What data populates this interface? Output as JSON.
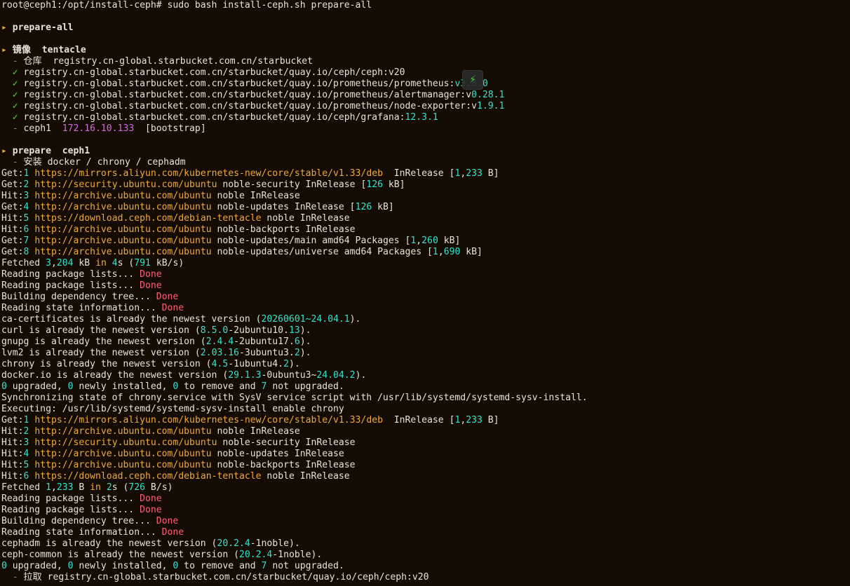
{
  "terminal": {
    "title": "root@ceph1:/opt/install-ceph",
    "palette": {
      "background": "#140c02",
      "text": "#e8e3da",
      "orange": "#f0a93c",
      "green": "#44dd28",
      "dim": "#8a8478",
      "cyan": "#34e2cf",
      "magenta": "#d36ce0",
      "red": "#ff5f77"
    },
    "overlay_badge": {
      "icon": "lightning-icon",
      "glyph": "⚡"
    },
    "lines": [
      [
        [
          "w",
          "root@ceph1:/opt/install-ceph# sudo bash install-ceph.sh prepare-all"
        ]
      ],
      [],
      [
        [
          "o",
          "▸ "
        ],
        [
          "b",
          "prepare-all"
        ]
      ],
      [],
      [
        [
          "o",
          "▸ "
        ],
        [
          "b",
          "镜像  tentacle"
        ]
      ],
      [
        [
          "d",
          "  - "
        ],
        [
          "w",
          "仓库  registry.cn-global.starbucket.com.cn/starbucket"
        ]
      ],
      [
        [
          "g",
          "  ✓ "
        ],
        [
          "w",
          "registry.cn-global.starbucket.com.cn/starbucket/quay.io/ceph/ceph:v20"
        ]
      ],
      [
        [
          "g",
          "  ✓ "
        ],
        [
          "w",
          "registry.cn-global.starbucket.com.cn/starbucket/quay.io/prometheus/prometheus:"
        ],
        [
          "c",
          "v3.8.0"
        ]
      ],
      [
        [
          "g",
          "  ✓ "
        ],
        [
          "w",
          "registry.cn-global.starbucket.com.cn/starbucket/quay.io/prometheus/alertmanager:v"
        ],
        [
          "c",
          "0.28.1"
        ]
      ],
      [
        [
          "g",
          "  ✓ "
        ],
        [
          "w",
          "registry.cn-global.starbucket.com.cn/starbucket/quay.io/prometheus/node-exporter:v"
        ],
        [
          "c",
          "1.9.1"
        ]
      ],
      [
        [
          "g",
          "  ✓ "
        ],
        [
          "w",
          "registry.cn-global.starbucket.com.cn/starbucket/quay.io/ceph/grafana:"
        ],
        [
          "c",
          "12.3.1"
        ]
      ],
      [
        [
          "d",
          "  - "
        ],
        [
          "w",
          "ceph1  "
        ],
        [
          "m",
          "172.16.10.133"
        ],
        [
          "w",
          "  [bootstrap]"
        ]
      ],
      [],
      [
        [
          "o",
          "▸ "
        ],
        [
          "b",
          "prepare  ceph1"
        ]
      ],
      [
        [
          "d",
          "  - "
        ],
        [
          "w",
          "安装 docker / chrony / cephadm"
        ]
      ],
      [
        [
          "w",
          "Get:"
        ],
        [
          "c",
          "1"
        ],
        [
          "w",
          " "
        ],
        [
          "o",
          "https://mirrors.aliyun.com/kubernetes-new/core/stable/v1.33/deb"
        ],
        [
          "w",
          "  InRelease ["
        ],
        [
          "c",
          "1"
        ],
        [
          "w",
          ","
        ],
        [
          "c",
          "233"
        ],
        [
          "w",
          " B]"
        ]
      ],
      [
        [
          "w",
          "Get:"
        ],
        [
          "c",
          "2"
        ],
        [
          "w",
          " "
        ],
        [
          "o",
          "http://security.ubuntu.com/ubuntu"
        ],
        [
          "w",
          " noble-security InRelease ["
        ],
        [
          "c",
          "126"
        ],
        [
          "w",
          " kB]"
        ]
      ],
      [
        [
          "w",
          "Hit:"
        ],
        [
          "c",
          "3"
        ],
        [
          "w",
          " "
        ],
        [
          "o",
          "http://archive.ubuntu.com/ubuntu"
        ],
        [
          "w",
          " noble InRelease"
        ]
      ],
      [
        [
          "w",
          "Get:"
        ],
        [
          "c",
          "4"
        ],
        [
          "w",
          " "
        ],
        [
          "o",
          "http://archive.ubuntu.com/ubuntu"
        ],
        [
          "w",
          " noble-updates InRelease ["
        ],
        [
          "c",
          "126"
        ],
        [
          "w",
          " kB]"
        ]
      ],
      [
        [
          "w",
          "Hit:"
        ],
        [
          "c",
          "5"
        ],
        [
          "w",
          " "
        ],
        [
          "o",
          "https://download.ceph.com/debian-tentacle"
        ],
        [
          "w",
          " noble InRelease"
        ]
      ],
      [
        [
          "w",
          "Hit:"
        ],
        [
          "c",
          "6"
        ],
        [
          "w",
          " "
        ],
        [
          "o",
          "http://archive.ubuntu.com/ubuntu"
        ],
        [
          "w",
          " noble-backports InRelease"
        ]
      ],
      [
        [
          "w",
          "Get:"
        ],
        [
          "c",
          "7"
        ],
        [
          "w",
          " "
        ],
        [
          "o",
          "http://archive.ubuntu.com/ubuntu"
        ],
        [
          "w",
          " noble-updates/main amd64 Packages ["
        ],
        [
          "c",
          "1"
        ],
        [
          "w",
          ","
        ],
        [
          "c",
          "260"
        ],
        [
          "w",
          " kB]"
        ]
      ],
      [
        [
          "w",
          "Get:"
        ],
        [
          "c",
          "8"
        ],
        [
          "w",
          " "
        ],
        [
          "o",
          "http://archive.ubuntu.com/ubuntu"
        ],
        [
          "w",
          " noble-updates/universe amd64 Packages ["
        ],
        [
          "c",
          "1"
        ],
        [
          "w",
          ","
        ],
        [
          "c",
          "690"
        ],
        [
          "w",
          " kB]"
        ]
      ],
      [
        [
          "w",
          "Fetched "
        ],
        [
          "c",
          "3"
        ],
        [
          "w",
          ","
        ],
        [
          "c",
          "204"
        ],
        [
          "w",
          " kB "
        ],
        [
          "o",
          "in"
        ],
        [
          "w",
          " "
        ],
        [
          "c",
          "4"
        ],
        [
          "w",
          "s ("
        ],
        [
          "c",
          "791"
        ],
        [
          "w",
          " kB/s)"
        ]
      ],
      [
        [
          "w",
          "Reading package lists... "
        ],
        [
          "r",
          "Done"
        ]
      ],
      [
        [
          "w",
          "Reading package lists... "
        ],
        [
          "r",
          "Done"
        ]
      ],
      [
        [
          "w",
          "Building dependency tree... "
        ],
        [
          "r",
          "Done"
        ]
      ],
      [
        [
          "w",
          "Reading state information... "
        ],
        [
          "r",
          "Done"
        ]
      ],
      [
        [
          "w",
          "ca-certificates is already the newest version ("
        ],
        [
          "c",
          "20260601~24.04.1"
        ],
        [
          "w",
          ")."
        ]
      ],
      [
        [
          "w",
          "curl is already the newest version ("
        ],
        [
          "c",
          "8.5.0"
        ],
        [
          "w",
          "-2ubuntu10."
        ],
        [
          "c",
          "13"
        ],
        [
          "w",
          ")."
        ]
      ],
      [
        [
          "w",
          "gnupg is already the newest version ("
        ],
        [
          "c",
          "2.4.4"
        ],
        [
          "w",
          "-2ubuntu17."
        ],
        [
          "c",
          "6"
        ],
        [
          "w",
          ")."
        ]
      ],
      [
        [
          "w",
          "lvm2 is already the newest version ("
        ],
        [
          "c",
          "2.03.16"
        ],
        [
          "w",
          "-3ubuntu3."
        ],
        [
          "c",
          "2"
        ],
        [
          "w",
          ")."
        ]
      ],
      [
        [
          "w",
          "chrony is already the newest version ("
        ],
        [
          "c",
          "4.5"
        ],
        [
          "w",
          "-1ubuntu4."
        ],
        [
          "c",
          "2"
        ],
        [
          "w",
          ")."
        ]
      ],
      [
        [
          "w",
          "docker.io is already the newest version ("
        ],
        [
          "c",
          "29.1.3"
        ],
        [
          "w",
          "-0ubuntu3~"
        ],
        [
          "c",
          "24.04.2"
        ],
        [
          "w",
          ")."
        ]
      ],
      [
        [
          "c",
          "0"
        ],
        [
          "w",
          " upgraded, "
        ],
        [
          "c",
          "0"
        ],
        [
          "w",
          " newly installed, "
        ],
        [
          "c",
          "0"
        ],
        [
          "w",
          " to remove and "
        ],
        [
          "c",
          "7"
        ],
        [
          "w",
          " not upgraded."
        ]
      ],
      [
        [
          "w",
          "Synchronizing state of chrony.service with SysV service script with /usr/lib/systemd/systemd-sysv-install."
        ]
      ],
      [
        [
          "w",
          "Executing: /usr/lib/systemd/systemd-sysv-install enable chrony"
        ]
      ],
      [
        [
          "w",
          "Get:"
        ],
        [
          "c",
          "1"
        ],
        [
          "w",
          " "
        ],
        [
          "o",
          "https://mirrors.aliyun.com/kubernetes-new/core/stable/v1.33/deb"
        ],
        [
          "w",
          "  InRelease ["
        ],
        [
          "c",
          "1"
        ],
        [
          "w",
          ","
        ],
        [
          "c",
          "233"
        ],
        [
          "w",
          " B]"
        ]
      ],
      [
        [
          "w",
          "Hit:"
        ],
        [
          "c",
          "2"
        ],
        [
          "w",
          " "
        ],
        [
          "o",
          "http://archive.ubuntu.com/ubuntu"
        ],
        [
          "w",
          " noble InRelease"
        ]
      ],
      [
        [
          "w",
          "Hit:"
        ],
        [
          "c",
          "3"
        ],
        [
          "w",
          " "
        ],
        [
          "o",
          "http://security.ubuntu.com/ubuntu"
        ],
        [
          "w",
          " noble-security InRelease"
        ]
      ],
      [
        [
          "w",
          "Hit:"
        ],
        [
          "c",
          "4"
        ],
        [
          "w",
          " "
        ],
        [
          "o",
          "http://archive.ubuntu.com/ubuntu"
        ],
        [
          "w",
          " noble-updates InRelease"
        ]
      ],
      [
        [
          "w",
          "Hit:"
        ],
        [
          "c",
          "5"
        ],
        [
          "w",
          " "
        ],
        [
          "o",
          "http://archive.ubuntu.com/ubuntu"
        ],
        [
          "w",
          " noble-backports InRelease"
        ]
      ],
      [
        [
          "w",
          "Hit:"
        ],
        [
          "c",
          "6"
        ],
        [
          "w",
          " "
        ],
        [
          "o",
          "https://download.ceph.com/debian-tentacle"
        ],
        [
          "w",
          " noble InRelease"
        ]
      ],
      [
        [
          "w",
          "Fetched "
        ],
        [
          "c",
          "1"
        ],
        [
          "w",
          ","
        ],
        [
          "c",
          "233"
        ],
        [
          "w",
          " B "
        ],
        [
          "o",
          "in"
        ],
        [
          "w",
          " "
        ],
        [
          "c",
          "2"
        ],
        [
          "w",
          "s ("
        ],
        [
          "c",
          "726"
        ],
        [
          "w",
          " B/s)"
        ]
      ],
      [
        [
          "w",
          "Reading package lists... "
        ],
        [
          "r",
          "Done"
        ]
      ],
      [
        [
          "w",
          "Reading package lists... "
        ],
        [
          "r",
          "Done"
        ]
      ],
      [
        [
          "w",
          "Building dependency tree... "
        ],
        [
          "r",
          "Done"
        ]
      ],
      [
        [
          "w",
          "Reading state information... "
        ],
        [
          "r",
          "Done"
        ]
      ],
      [
        [
          "w",
          "cephadm is already the newest version ("
        ],
        [
          "c",
          "20.2.4"
        ],
        [
          "w",
          "-1noble)."
        ]
      ],
      [
        [
          "w",
          "ceph-common is already the newest version ("
        ],
        [
          "c",
          "20.2.4"
        ],
        [
          "w",
          "-1noble)."
        ]
      ],
      [
        [
          "c",
          "0"
        ],
        [
          "w",
          " upgraded, "
        ],
        [
          "c",
          "0"
        ],
        [
          "w",
          " newly installed, "
        ],
        [
          "c",
          "0"
        ],
        [
          "w",
          " to remove and "
        ],
        [
          "c",
          "7"
        ],
        [
          "w",
          " not upgraded."
        ]
      ],
      [
        [
          "d",
          "  - "
        ],
        [
          "w",
          "拉取 registry.cn-global.starbucket.com.cn/starbucket/quay.io/ceph/ceph:v20"
        ]
      ]
    ]
  }
}
